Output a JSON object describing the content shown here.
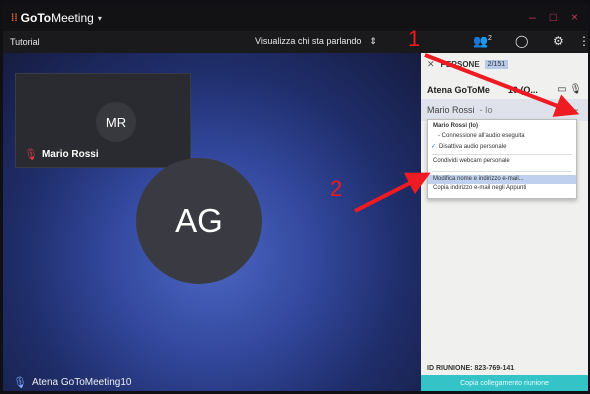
{
  "app": {
    "logo_glyph": "⁞⁞",
    "title_bold": "GoTo",
    "title_rest": "Meeting",
    "chevron": "▾",
    "minimize": "–",
    "maximize": "□",
    "close": "×"
  },
  "toolbar": {
    "meeting_name": "Tutorial",
    "speaker_view": "Visualizza chi sta parlando",
    "sort_icon": "⇕",
    "people_icon": "👥",
    "people_badge": "2",
    "chat_icon": "◯",
    "settings_icon": "⚙",
    "more_icon": "⋮"
  },
  "stage": {
    "tile": {
      "initials": "MR",
      "name": "Mario Rossi",
      "mic_icon": "🎙"
    },
    "big_initials": "AG",
    "footer_name": "Atena GoToMeeting10",
    "footer_mic_icon": "🎙"
  },
  "panel": {
    "close_icon": "✕",
    "header_label": "PERSONE",
    "count": "2/151",
    "person1": {
      "name": "Atena GoToMe",
      "suffix": "10 (O...",
      "icons": "▭ 🎙"
    },
    "person2": {
      "name": "Mario Rossi",
      "tag": "- Io",
      "chevron": "⌄"
    },
    "menu": {
      "title": "Mario Rossi (Io)",
      "audio": "- Connessione all'audio eseguita",
      "check": "✓",
      "mute": "Disattiva audio personale",
      "webcam": "Condividi webcam personale",
      "edit": "Modifica nome e indirizzo e-mail...",
      "copy": "Copia indirizzo e-mail negli Appunti"
    },
    "meeting_id_label": "ID RIUNIONE:",
    "meeting_id": "823-769-141",
    "copy_link": "Copia collegamento riunione"
  },
  "annotations": {
    "one": "1",
    "two": "2",
    "arrow_color": "#ee1b22"
  },
  "colors": {
    "accent_teal": "#34c4c8",
    "brand_orange": "#f26b2b",
    "muted_red": "#e03b46"
  }
}
